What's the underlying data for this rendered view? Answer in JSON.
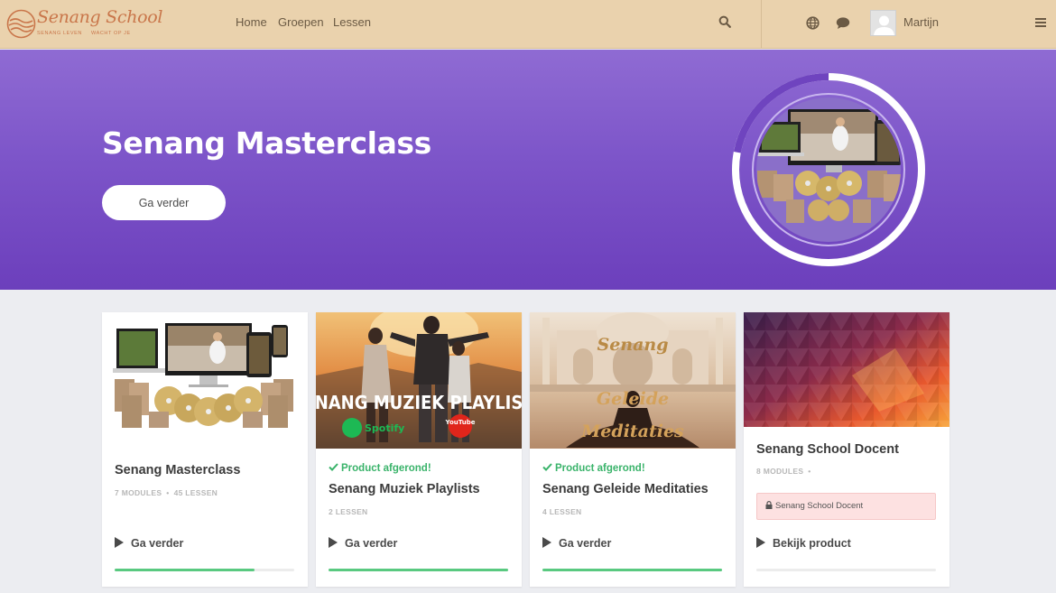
{
  "header": {
    "logo_name": "Senang School",
    "logo_tagline_left": "SENANG LEVEN",
    "logo_tagline_right": "WACHT OP JE",
    "nav": [
      "Home",
      "Groepen",
      "Lessen"
    ],
    "user_name": "Martijn",
    "colors": {
      "background": "#ead2ad",
      "brand": "#c9764a"
    },
    "icons": [
      "search-icon",
      "globe-icon",
      "chat-icon",
      "menu-icon"
    ]
  },
  "hero": {
    "title": "Senang Masterclass",
    "button_label": "Ga verder",
    "progress": 0.78,
    "colors": {
      "gradient_top": "#8f6bd3",
      "gradient_bottom": "#6c3fbc"
    }
  },
  "cards": [
    {
      "title": "Senang Masterclass",
      "modules": "7 MODULES",
      "lessons": "45 LESSEN",
      "completed_label": "",
      "action_label": "Ga verder",
      "progress": 0.78
    },
    {
      "title": "Senang Muziek Playlists",
      "thumb_text": "SENANG MUZIEK PLAYLISTS",
      "thumb_badge_spotify": "Spotify",
      "thumb_badge_youtube": "YouTube",
      "completed_label": "Product afgerond!",
      "lessons": "2 LESSEN",
      "action_label": "Ga verder",
      "progress": 1.0
    },
    {
      "title": "Senang Geleide Meditaties",
      "thumb_line1": "Senang",
      "thumb_line2": "Geleide",
      "thumb_line3": "Meditaties",
      "completed_label": "Product afgerond!",
      "lessons": "4 LESSEN",
      "action_label": "Ga verder",
      "progress": 1.0
    },
    {
      "title": "Senang School Docent",
      "modules": "8 MODULES",
      "access_label": "Senang School Docent",
      "action_label": "Bekijk product",
      "progress": 0.0
    }
  ],
  "colors": {
    "progress": "#59c980",
    "completed": "#39b36a",
    "page_bg": "#ecedf1"
  }
}
